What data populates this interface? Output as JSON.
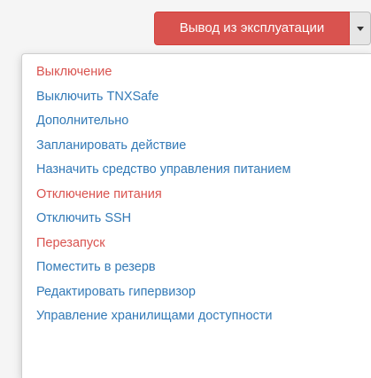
{
  "action_button": {
    "label": "Вывод из эксплуатации",
    "color": "#d9534f"
  },
  "toggle": {
    "icon": "caret-down-icon"
  },
  "menu": {
    "items": [
      {
        "label": "Выключение",
        "variant": "danger"
      },
      {
        "label": "Выключить TNXSafe",
        "variant": "normal"
      },
      {
        "label": "Дополнительно",
        "variant": "normal"
      },
      {
        "label": "Запланировать действие",
        "variant": "normal"
      },
      {
        "label": "Назначить средство управления питанием",
        "variant": "normal"
      },
      {
        "label": "Отключение питания",
        "variant": "danger"
      },
      {
        "label": "Отключить SSH",
        "variant": "normal"
      },
      {
        "label": "Перезапуск",
        "variant": "danger"
      },
      {
        "label": "Поместить в резерв",
        "variant": "normal"
      },
      {
        "label": "Редактировать гипервизор",
        "variant": "normal"
      },
      {
        "label": "Управление хранилищами доступности",
        "variant": "normal"
      }
    ]
  },
  "colors": {
    "danger": "#d9534f",
    "link": "#337ab7",
    "background": "#f5f5f5",
    "menu_background": "#ffffff"
  }
}
